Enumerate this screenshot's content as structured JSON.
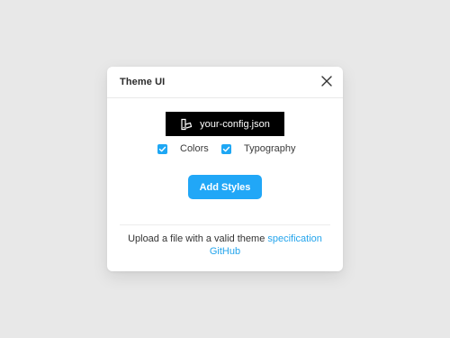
{
  "modal": {
    "title": "Theme UI",
    "file_button_label": "your-config.json",
    "options": [
      {
        "label": "Colors",
        "checked": true
      },
      {
        "label": "Typography",
        "checked": true
      }
    ],
    "add_button_label": "Add Styles",
    "footer": {
      "text": "Upload a file with a valid theme",
      "link_spec": "specification",
      "link_github": "GitHub"
    }
  },
  "colors": {
    "accent": "#21a7f7",
    "link": "#23a4ec",
    "file_button_bg": "#000000",
    "background": "#e8e8e8"
  },
  "icons": {
    "close": "close-icon",
    "file": "file-icon",
    "checkbox": "checkmark-icon"
  }
}
